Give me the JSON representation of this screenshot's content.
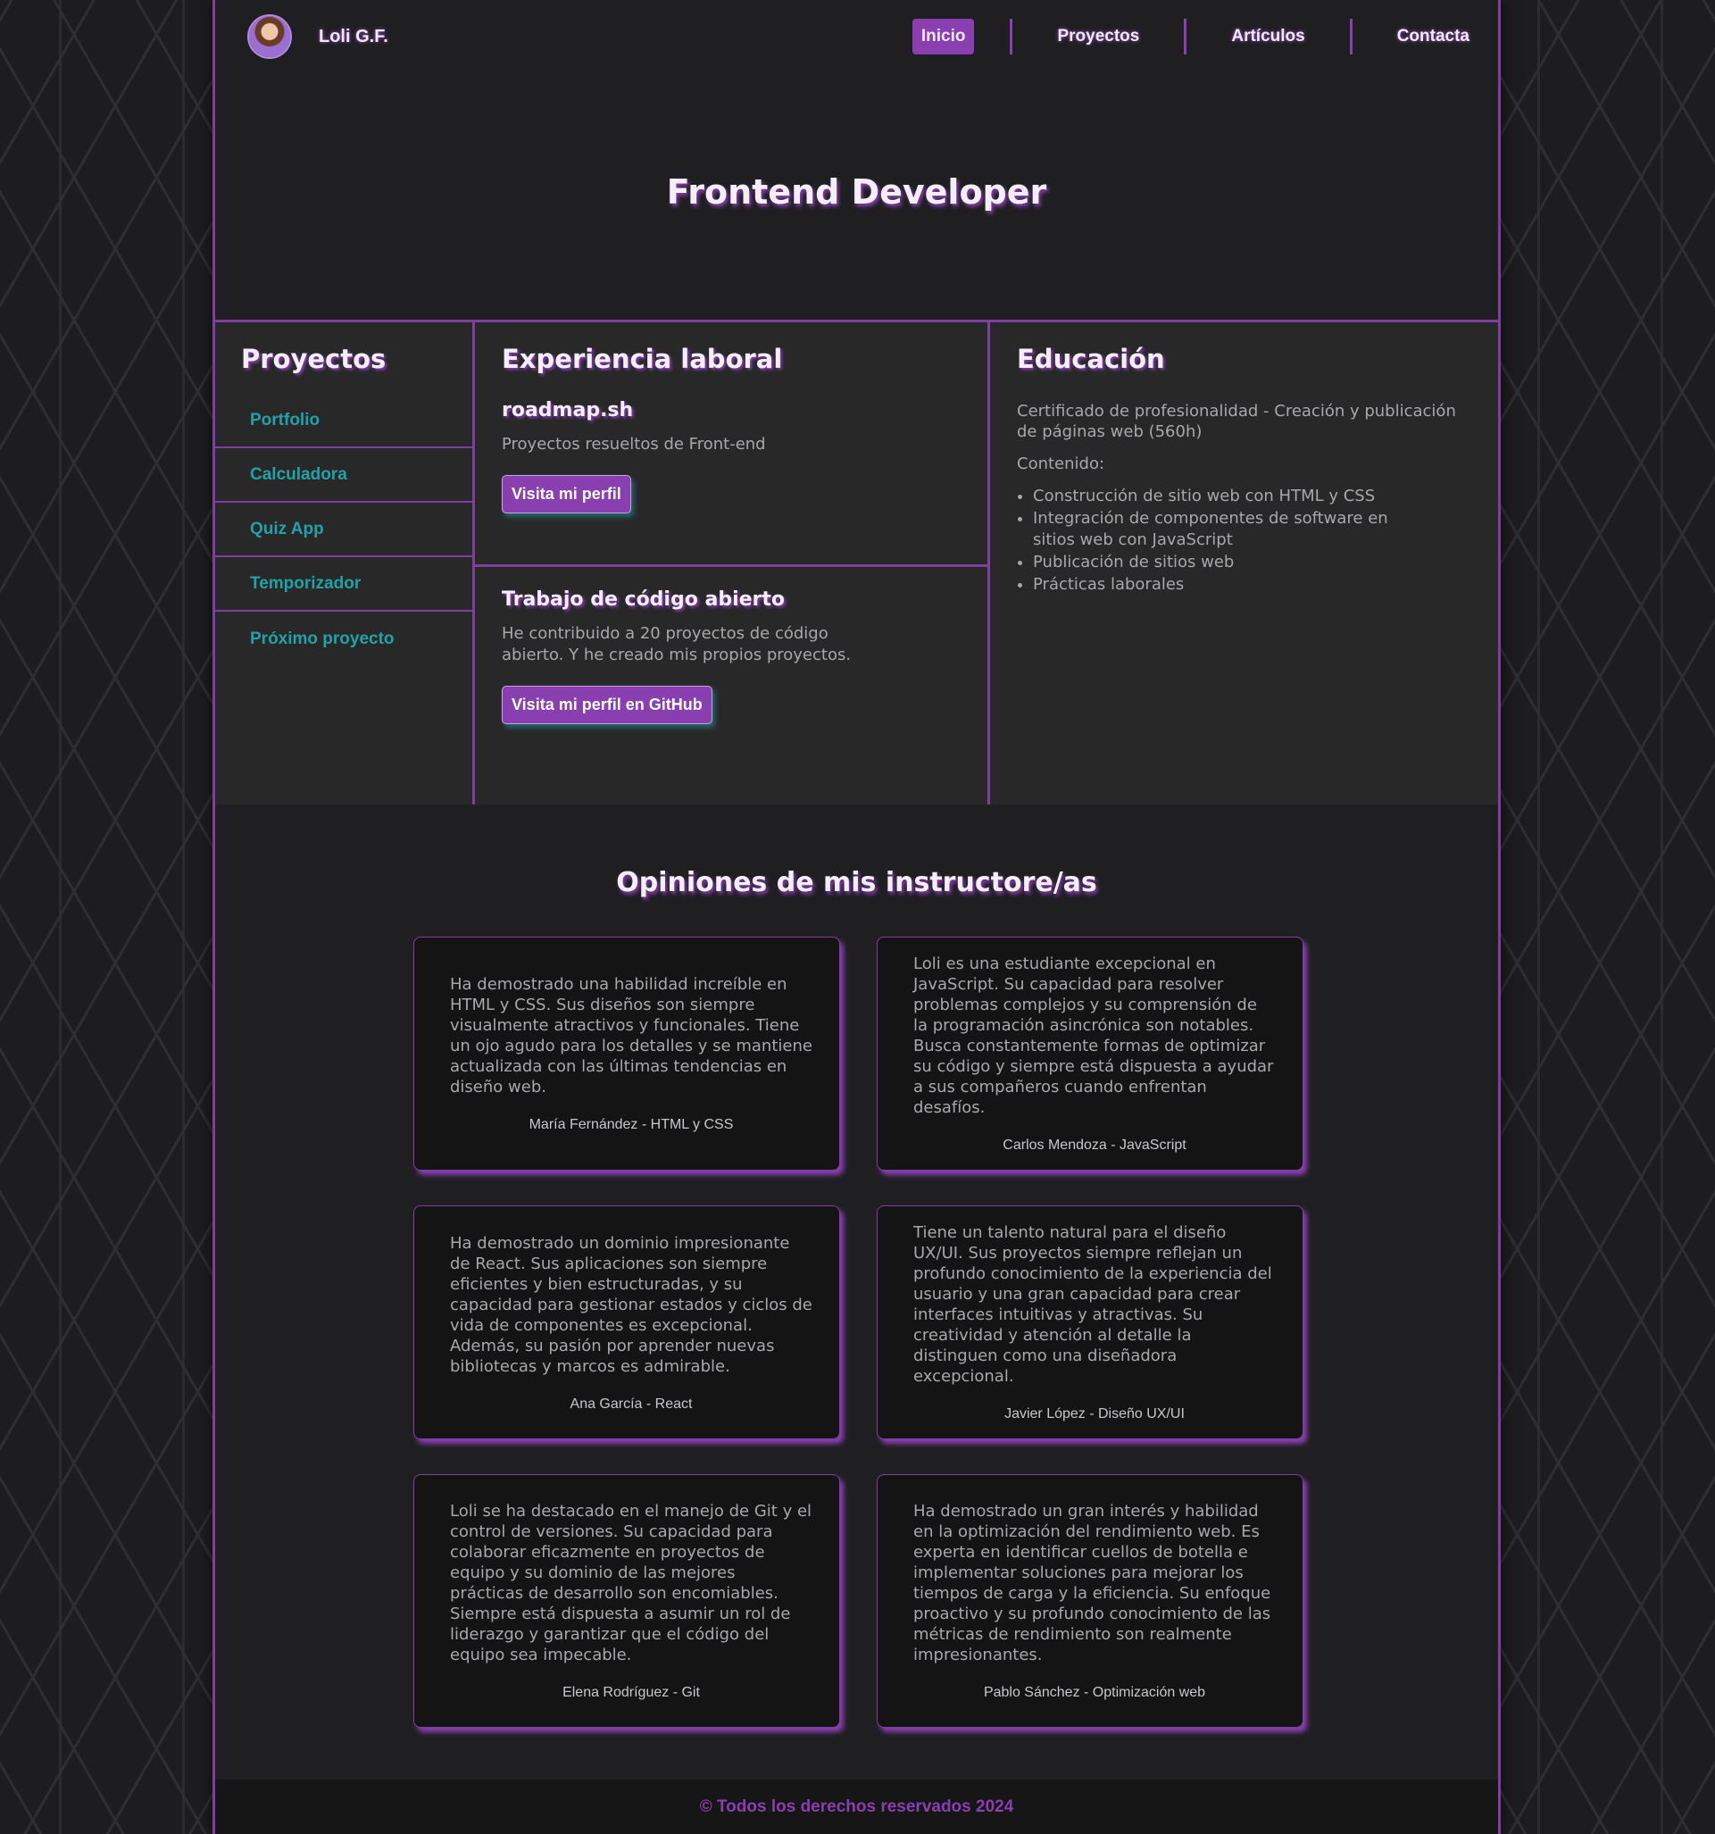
{
  "header": {
    "brand": "Loli G.F.",
    "nav": [
      "Inicio",
      "Proyectos",
      "Artículos",
      "Contacta"
    ]
  },
  "hero": {
    "title": "Frontend Developer"
  },
  "projects": {
    "title": "Proyectos",
    "items": [
      "Portfolio",
      "Calculadora",
      "Quiz App",
      "Temporizador",
      "Próximo proyecto"
    ]
  },
  "experience": {
    "title": "Experiencia laboral",
    "jobs": [
      {
        "name": "roadmap.sh",
        "text": "Proyectos resueltos de Front-end",
        "button": "Visita mi perfil"
      },
      {
        "name": "Trabajo de código abierto",
        "text": "He contribuido a 20 proyectos de código abierto. Y he creado mis propios proyectos.",
        "button": "Visita mi perfil en GitHub"
      }
    ]
  },
  "education": {
    "title": "Educación",
    "text": "Certificado de profesionalidad - Creación y publicación de páginas web (560h)",
    "label": "Contenido:",
    "items": [
      "Construcción de sitio web con HTML y CSS",
      "Integración de componentes de software en sitios web con JavaScript",
      "Publicación de sitios web",
      "Prácticas laborales"
    ]
  },
  "opinions": {
    "title": "Opiniones de mis instructore/as",
    "cards": [
      {
        "text": "Ha demostrado una habilidad increíble en HTML y CSS. Sus diseños son siempre visualmente atractivos y funcionales. Tiene un ojo agudo para los detalles y se mantiene actualizada con las últimas tendencias en diseño web.",
        "author": "María Fernández - HTML y CSS"
      },
      {
        "text": "Loli es una estudiante excepcional en JavaScript. Su capacidad para resolver problemas complejos y su comprensión de la programación asincrónica son notables. Busca constantemente formas de optimizar su código y siempre está dispuesta a ayudar a sus compañeros cuando enfrentan desafíos.",
        "author": "Carlos Mendoza - JavaScript"
      },
      {
        "text": "Ha demostrado un dominio impresionante de React. Sus aplicaciones son siempre eficientes y bien estructuradas, y su capacidad para gestionar estados y ciclos de vida de componentes es excepcional. Además, su pasión por aprender nuevas bibliotecas y marcos es admirable.",
        "author": "Ana García - React"
      },
      {
        "text": "Tiene un talento natural para el diseño UX/UI. Sus proyectos siempre reflejan un profundo conocimiento de la experiencia del usuario y una gran capacidad para crear interfaces intuitivas y atractivas. Su creatividad y atención al detalle la distinguen como una diseñadora excepcional.",
        "author": "Javier López - Diseño UX/UI"
      },
      {
        "text": "Loli se ha destacado en el manejo de Git y el control de versiones. Su capacidad para colaborar eficazmente en proyectos de equipo y su dominio de las mejores prácticas de desarrollo son encomiables. Siempre está dispuesta a asumir un rol de liderazgo y garantizar que el código del equipo sea impecable.",
        "author": "Elena Rodríguez - Git"
      },
      {
        "text": "Ha demostrado un gran interés y habilidad en la optimización del rendimiento web. Es experta en identificar cuellos de botella e implementar soluciones para mejorar los tiempos de carga y la eficiencia. Su enfoque proactivo y su profundo conocimiento de las métricas de rendimiento son realmente impresionantes.",
        "author": "Pablo Sánchez - Optimización web"
      }
    ]
  },
  "footer": {
    "text": "© Todos los derechos reservados 2024"
  },
  "colors": {
    "accent": "#8a3fb0",
    "link": "#1fa3a8",
    "background": "#1f1f21"
  }
}
